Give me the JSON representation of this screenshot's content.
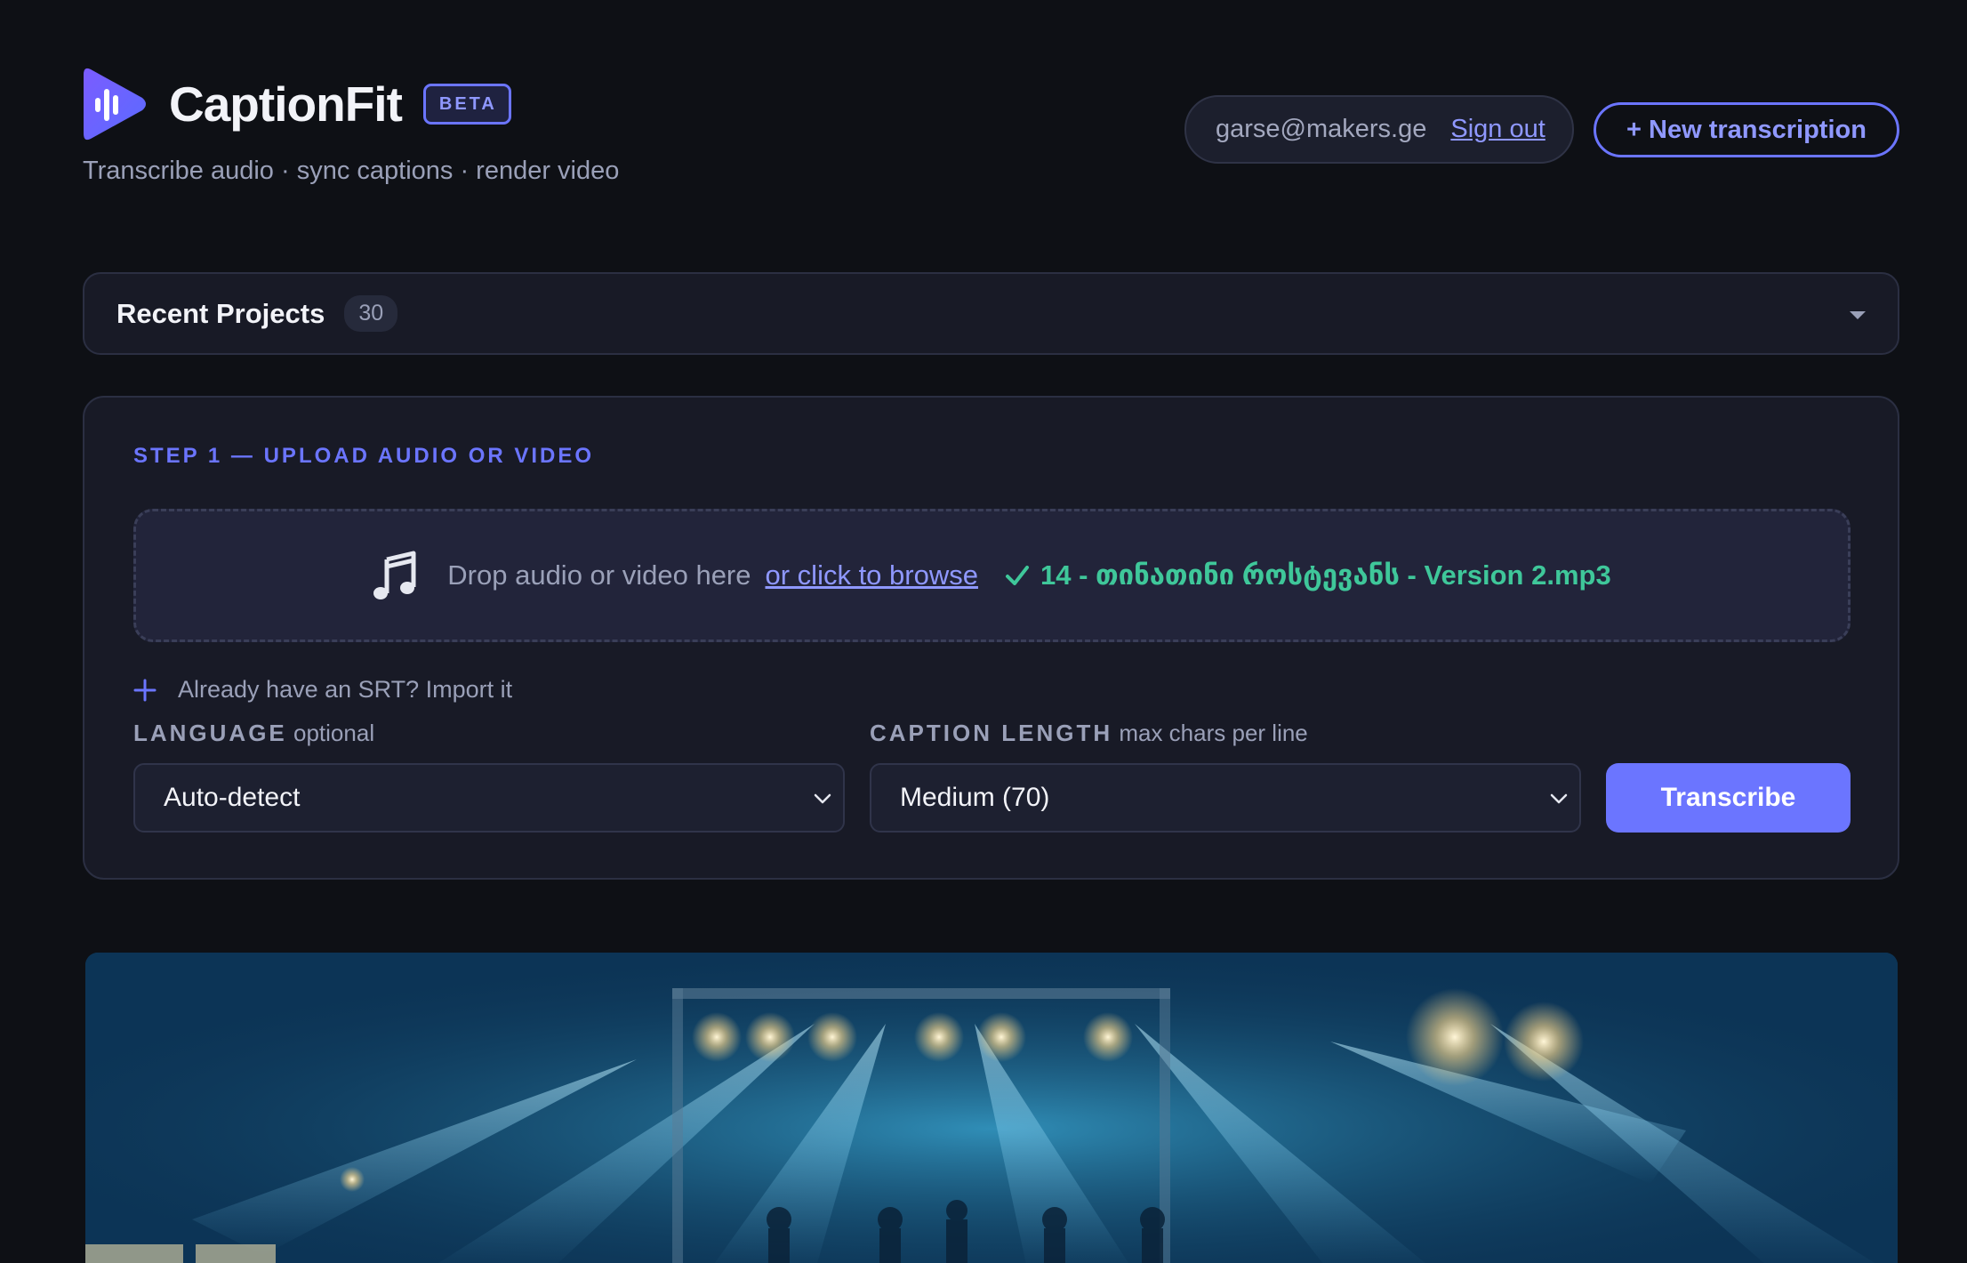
{
  "header": {
    "app_title": "CaptionFit",
    "badge": "BETA",
    "tagline": "Transcribe audio · sync captions · render video",
    "user_email": "garse@makers.ge",
    "sign_out": "Sign out",
    "new_transcription": "+ New transcription"
  },
  "recent_projects": {
    "title": "Recent Projects",
    "count": "30"
  },
  "step1": {
    "label": "STEP 1 — UPLOAD AUDIO OR VIDEO",
    "drop_text": "Drop audio or video here",
    "browse_link": "or click to browse",
    "uploaded_file": "14 - თინათინი როსტევანს - Version 2.mp3",
    "srt_import": "Already have an SRT? Import it",
    "language_label": "LANGUAGE",
    "language_hint": "optional",
    "language_value": "Auto-detect",
    "caption_length_label": "CAPTION LENGTH",
    "caption_length_hint": "max chars per line",
    "caption_length_value": "Medium (70)",
    "transcribe_button": "Transcribe"
  },
  "colors": {
    "accent": "#6b75ff",
    "success": "#3fc79a",
    "background": "#0e1015",
    "card": "#181a26"
  }
}
